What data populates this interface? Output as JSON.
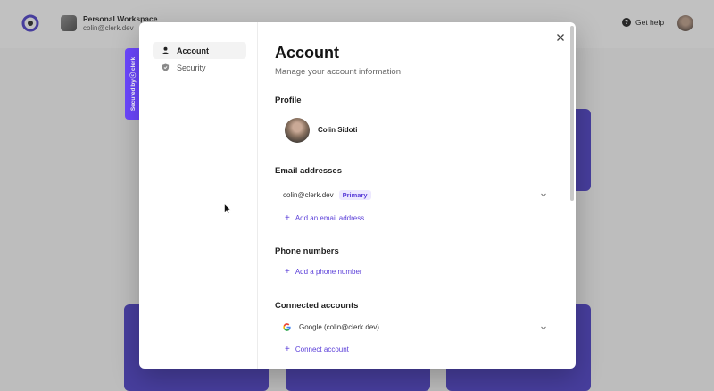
{
  "app": {
    "workspace_name": "Personal Workspace",
    "workspace_email": "colin@clerk.dev",
    "help_label": "Get help",
    "help_icon": "?"
  },
  "badge": {
    "label": "Secured by ⓒ clerk"
  },
  "nav": {
    "items": [
      {
        "label": "Account",
        "icon": "user-icon",
        "active": true
      },
      {
        "label": "Security",
        "icon": "shield-icon",
        "active": false
      }
    ]
  },
  "account": {
    "title": "Account",
    "subtitle": "Manage your account information",
    "profile": {
      "section": "Profile",
      "name": "Colin Sidoti"
    },
    "email": {
      "section": "Email addresses",
      "address": "colin@clerk.dev",
      "badge": "Primary",
      "add_label": "Add an email address"
    },
    "phone": {
      "section": "Phone numbers",
      "add_label": "Add a phone number"
    },
    "connected": {
      "section": "Connected accounts",
      "account": "Google (colin@clerk.dev)",
      "add_label": "Connect account"
    }
  },
  "colors": {
    "accent": "#5b3fd9",
    "badge_bg": "#6c47ff",
    "card": "#4b3fc2"
  }
}
